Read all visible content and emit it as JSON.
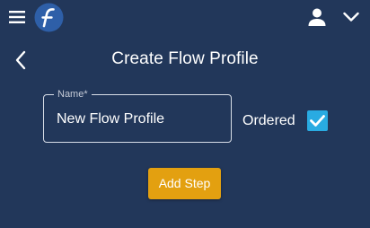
{
  "header": {
    "menu_icon": "hamburger-menu-icon",
    "logo_icon": "flow-logo-icon",
    "user_icon": "user-account-icon",
    "dropdown_icon": "chevron-down-icon"
  },
  "page": {
    "back_icon": "chevron-left-icon",
    "title": "Create Flow Profile"
  },
  "form": {
    "name_label": "Name*",
    "name_value": "New Flow Profile",
    "ordered_label": "Ordered",
    "ordered_checked": true,
    "add_step_label": "Add Step"
  },
  "colors": {
    "background": "#22375a",
    "checkbox_accent": "#29abe2",
    "button_accent": "#e3a010",
    "logo_circle": "#2e5fa8"
  }
}
